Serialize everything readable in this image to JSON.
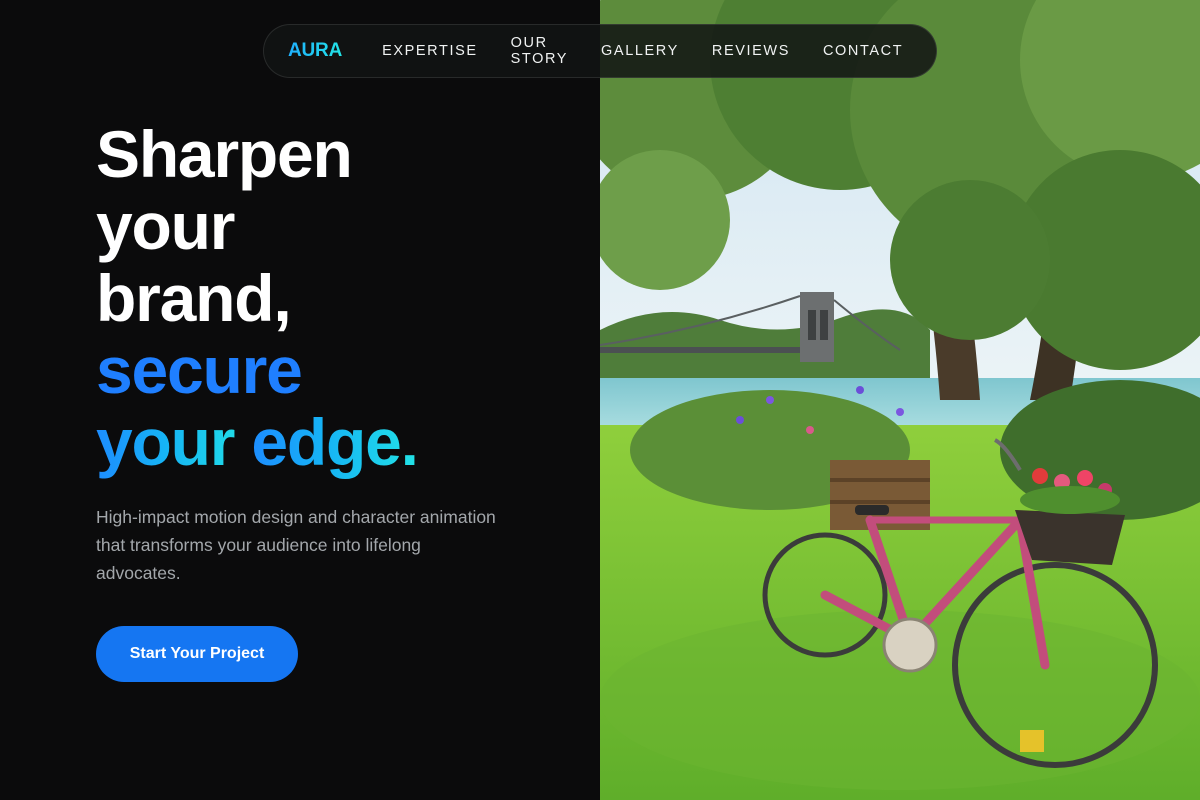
{
  "nav": {
    "logo": "AURA",
    "links": [
      "EXPERTISE",
      "OUR STORY",
      "GALLERY",
      "REVIEWS",
      "CONTACT"
    ]
  },
  "hero": {
    "headline": {
      "line1": "Sharpen",
      "line2": "your",
      "line3": "brand,",
      "line4": "secure",
      "line5a": "your ",
      "line5b": "edge."
    },
    "subtext": "High-impact motion design and character animation that transforms your audience into lifelong advocates.",
    "cta_label": "Start Your Project"
  },
  "colors": {
    "background": "#0b0b0c",
    "accent_blue": "#1576f2",
    "accent_cyan": "#22e3e6",
    "text_muted": "#a3a7ab"
  },
  "image": {
    "alt": "Pink bicycle with flower baskets on grass by a river with a suspension bridge"
  }
}
